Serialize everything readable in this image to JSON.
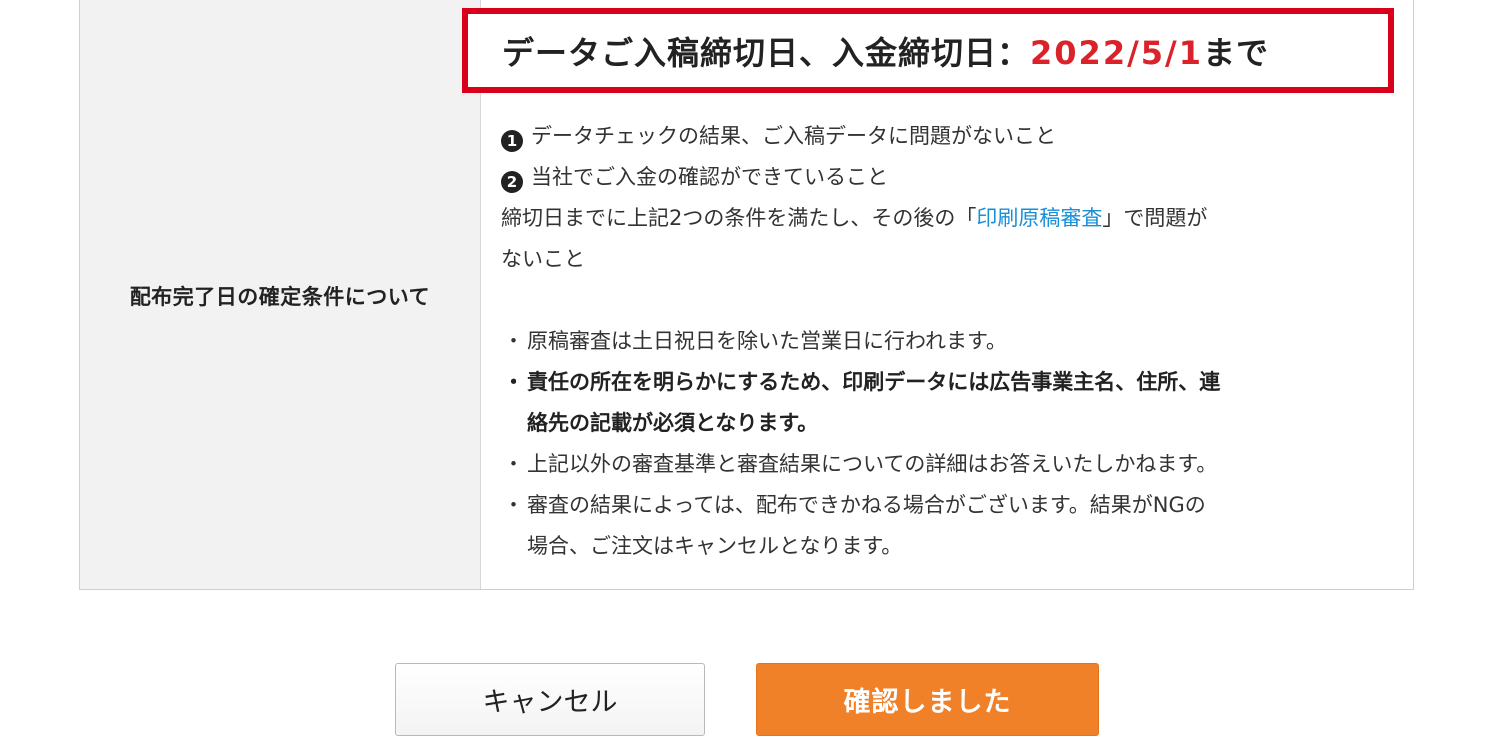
{
  "condition_row": {
    "label": "配布完了日の確定条件について",
    "deadline": {
      "prefix": "データご入稿締切日、入金締切日：",
      "date": "2022/5/1",
      "suffix": "まで",
      "highlight_color": "#d9001b",
      "date_color": "#d9222a"
    },
    "conditions": [
      {
        "number": "1",
        "text": "データチェックの結果、ご入稿データに問題がないこと"
      },
      {
        "number": "2",
        "text": "当社でご入金の確認ができていること"
      }
    ],
    "summary": {
      "before_link": "締切日までに上記2つの条件を満たし、その後の「",
      "link_text": "印刷原稿審査",
      "after_link": "」で問題が",
      "line2": "ないこと"
    },
    "notes": [
      {
        "bullet": "・",
        "lines": [
          "原稿審査は土日祝日を除いた営業日に行われます。"
        ],
        "bold": false
      },
      {
        "bullet": "・",
        "lines": [
          "責任の所在を明らかにするため、印刷データには広告事業主名、住所、連",
          "絡先の記載が必須となります。"
        ],
        "bold": true
      },
      {
        "bullet": "・",
        "lines": [
          "上記以外の審査基準と審査結果についての詳細はお答えいたしかねます。"
        ],
        "bold": false
      },
      {
        "bullet": "・",
        "lines": [
          "審査の結果によっては、配布できかねる場合がございます。結果がNGの",
          "場合、ご注文はキャンセルとなります。"
        ],
        "bold": false
      }
    ]
  },
  "buttons": {
    "cancel_label": "キャンセル",
    "confirm_label": "確認しました",
    "confirm_color": "#f08128"
  }
}
